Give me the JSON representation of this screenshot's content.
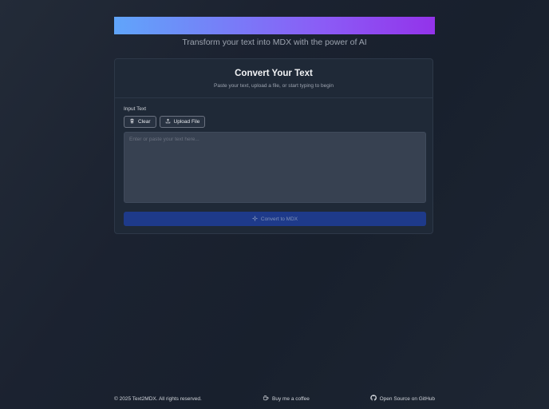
{
  "hero": {
    "tagline": "Transform your text into MDX with the power of AI"
  },
  "card": {
    "title": "Convert Your Text",
    "description": "Paste your text, upload a file, or start typing to begin",
    "input_label": "Input Text",
    "clear_label": "Clear",
    "upload_label": "Upload File",
    "textarea_placeholder": "Enter or paste your text here...",
    "textarea_value": "",
    "convert_label": "Convert to MDX"
  },
  "footer": {
    "copyright": "© 2025 Text2MDX. All rights reserved.",
    "coffee_label": "Buy me a coffee",
    "github_label": "Open Source on GitHub"
  },
  "icons": {
    "clear": "trash-icon",
    "upload": "upload-icon",
    "convert": "sparkles-icon",
    "coffee": "coffee-icon",
    "github": "github-icon"
  },
  "colors": {
    "banner_start": "#60a5fa",
    "banner_end": "#9333ea",
    "convert_button": "#1e3a8a",
    "card_background": "#1f2937"
  }
}
